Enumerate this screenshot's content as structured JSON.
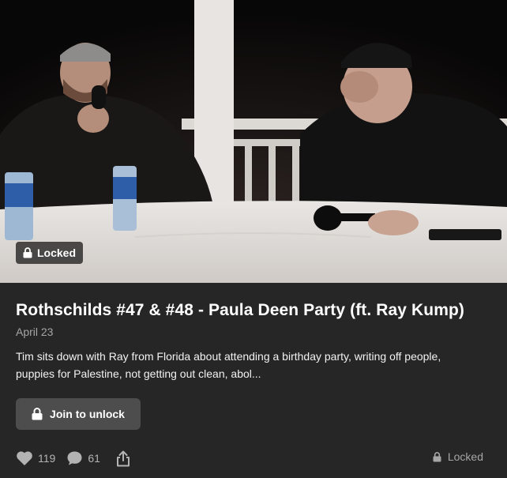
{
  "post": {
    "media_badge": "Locked",
    "title": "Rothschilds #47 & #48 - Paula Deen Party (ft. Ray Kump)",
    "date": "April 23",
    "description": "Tim sits down with Ray from Florida about attending a birthday party, writing off people, puppies for Palestine, not getting out clean, abol...",
    "join_label": "Join to unlock",
    "likes": "119",
    "comments": "61",
    "locked_status": "Locked"
  },
  "colors": {
    "background": "#262626",
    "button": "#4d4d4d",
    "muted_text": "#a6a6a6"
  },
  "icons": {
    "badge": "lock-icon",
    "join": "lock-icon",
    "likes": "heart-icon",
    "comments": "comment-bubble-icon",
    "share": "share-icon",
    "status": "lock-icon"
  }
}
